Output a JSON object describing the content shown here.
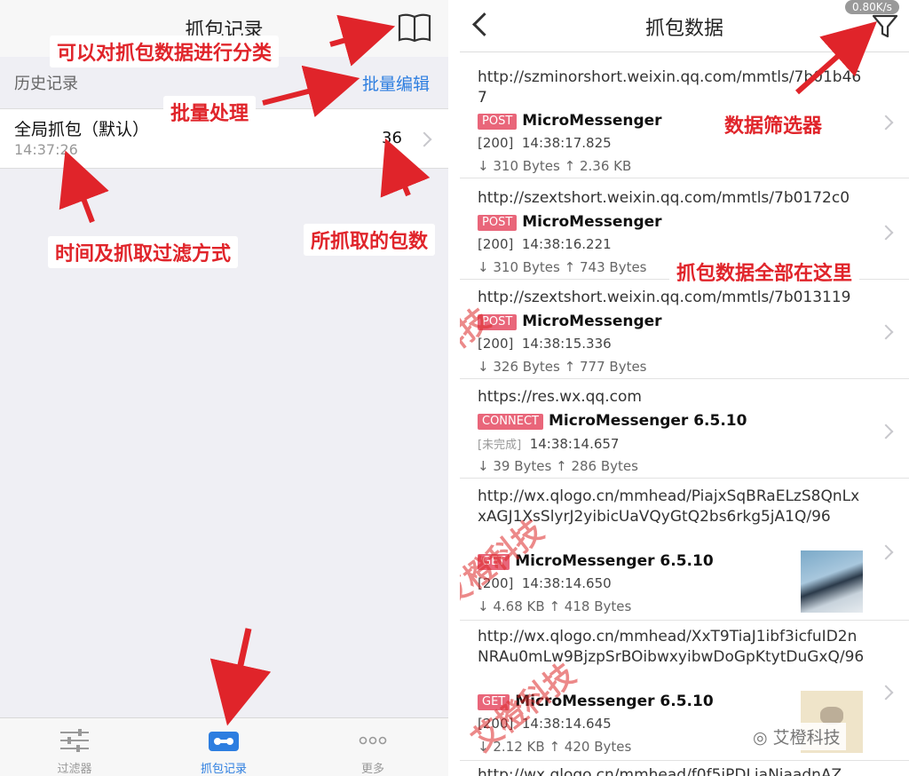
{
  "left": {
    "nav_title": "抓包记录",
    "history_label": "历史记录",
    "batch_edit": "批量编辑",
    "session": {
      "title": "全局抓包（默认）",
      "time": "14:37:26",
      "count": "36"
    },
    "tabs": [
      {
        "label": "过滤器",
        "icon": "sliders-icon"
      },
      {
        "label": "抓包记录",
        "icon": "cassette-icon"
      },
      {
        "label": "更多",
        "icon": "more-icon"
      }
    ],
    "annotations": {
      "classify": "可以对抓包数据进行分类",
      "batch": "批量处理",
      "time_filter": "时间及抓取过滤方式",
      "count": "所抓取的包数"
    }
  },
  "right": {
    "nav_title": "抓包数据",
    "rate": "0.80K/s",
    "annotations": {
      "filter": "数据筛选器",
      "all_data": "抓包数据全部在这里"
    },
    "packets": [
      {
        "url": "http://szminorshort.weixin.qq.com/mmtls/7b01b467",
        "method": "POST",
        "app": "MicroMessenger",
        "status": "[200]",
        "time": "14:38:17.825",
        "down": "310 Bytes",
        "up": "2.36 KB"
      },
      {
        "url": "http://szextshort.weixin.qq.com/mmtls/7b0172c0",
        "method": "POST",
        "app": "MicroMessenger",
        "status": "[200]",
        "time": "14:38:16.221",
        "down": "310 Bytes",
        "up": "743 Bytes"
      },
      {
        "url": "http://szextshort.weixin.qq.com/mmtls/7b013119",
        "method": "POST",
        "app": "MicroMessenger",
        "status": "[200]",
        "time": "14:38:15.336",
        "down": "326 Bytes",
        "up": "777 Bytes"
      },
      {
        "url": "https://res.wx.qq.com",
        "method": "CONNECT",
        "app": "MicroMessenger 6.5.10",
        "status": "[未完成]",
        "time": "14:38:14.657",
        "down": "39 Bytes",
        "up": "286 Bytes"
      },
      {
        "url": "http://wx.qlogo.cn/mmhead/PiajxSqBRaELzS8QnLxxAGJ1XsSlyrJ2yibicUaVQyGtQ2bs6rkg5jA1Q/96",
        "method": "GET",
        "app": "MicroMessenger 6.5.10",
        "status": "[200]",
        "time": "14:38:14.650",
        "down": "4.68 KB",
        "up": "418 Bytes"
      },
      {
        "url": "http://wx.qlogo.cn/mmhead/XxT9TiaJ1ibf3icfuID2nNRAu0mLw9BjzpSrBOibwxyibwDoGpKtytDuGxQ/96",
        "method": "GET",
        "app": "MicroMessenger 6.5.10",
        "status": "[200]",
        "time": "14:38:14.645",
        "down": "2.12 KB",
        "up": "420 Bytes"
      }
    ],
    "last_url_partial": "http://wx.qlogo.cn/mmhead/f0f5iPDLiaNiaadnAZ"
  },
  "watermark": "艾橙科技",
  "wechat_tag": "艾橙科技",
  "colors": {
    "accent": "#2d7ee0",
    "annotation": "#e0242a",
    "badge": "#e9667a"
  }
}
